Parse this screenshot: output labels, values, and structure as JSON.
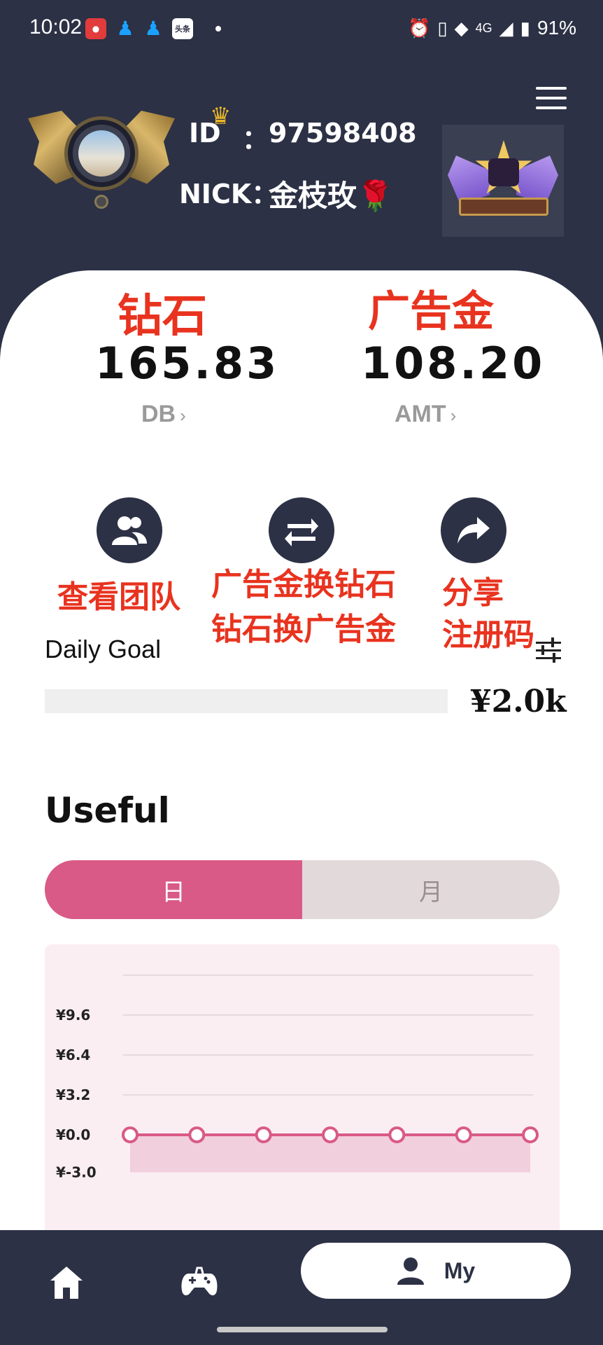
{
  "status_bar": {
    "time": "10:02",
    "network": "4G",
    "battery": "91%",
    "app_icons": [
      "app-icon-red",
      "qq-icon",
      "qq-icon",
      "toutiao-icon"
    ],
    "toutiao_label": "头条"
  },
  "profile": {
    "id_label": "ID",
    "id_colon": "：",
    "id_value": "97598408",
    "nick_label": "NICK：",
    "nick_value": "金枝玫🌹"
  },
  "balances": {
    "diamond_title": "钻石",
    "ad_title": "广告金",
    "db_value": "165.83",
    "db_unit": "DB",
    "amt_value": "108.20",
    "amt_unit": "AMT",
    "chevron": "›"
  },
  "actions": {
    "team_label": "查看团队",
    "exchange_label_1": "广告金换钻石",
    "exchange_label_2": "钻石换广告金",
    "share_label_1": "分享",
    "share_label_2": "注册码"
  },
  "daily_goal": {
    "label": "Daily Goal",
    "amount": "¥2.0k",
    "progress": 0
  },
  "useful": {
    "title": "Useful",
    "tabs": [
      "日",
      "月"
    ],
    "active_tab": 0
  },
  "chart_data": {
    "type": "line",
    "y_tick_labels": [
      "¥9.6",
      "¥6.4",
      "¥3.2",
      "¥0.0",
      "¥-3.0"
    ],
    "y_ticks": [
      9.6,
      6.4,
      3.2,
      0.0,
      -3.0
    ],
    "ylim": [
      -3.0,
      12.8
    ],
    "series": [
      {
        "values": [
          0,
          0,
          0,
          0,
          0,
          0,
          0
        ]
      }
    ],
    "colors": {
      "line": "#d95a86",
      "fill": "#f2cfdc",
      "grid": "#e6dadd"
    }
  },
  "bottom_nav": {
    "items": [
      "home-icon",
      "gamepad-icon",
      "user-icon"
    ],
    "my_label": "My"
  },
  "colors": {
    "header_bg": "#2c3145",
    "accent_pink": "#d95a86",
    "annotation_red": "#e8331f"
  }
}
